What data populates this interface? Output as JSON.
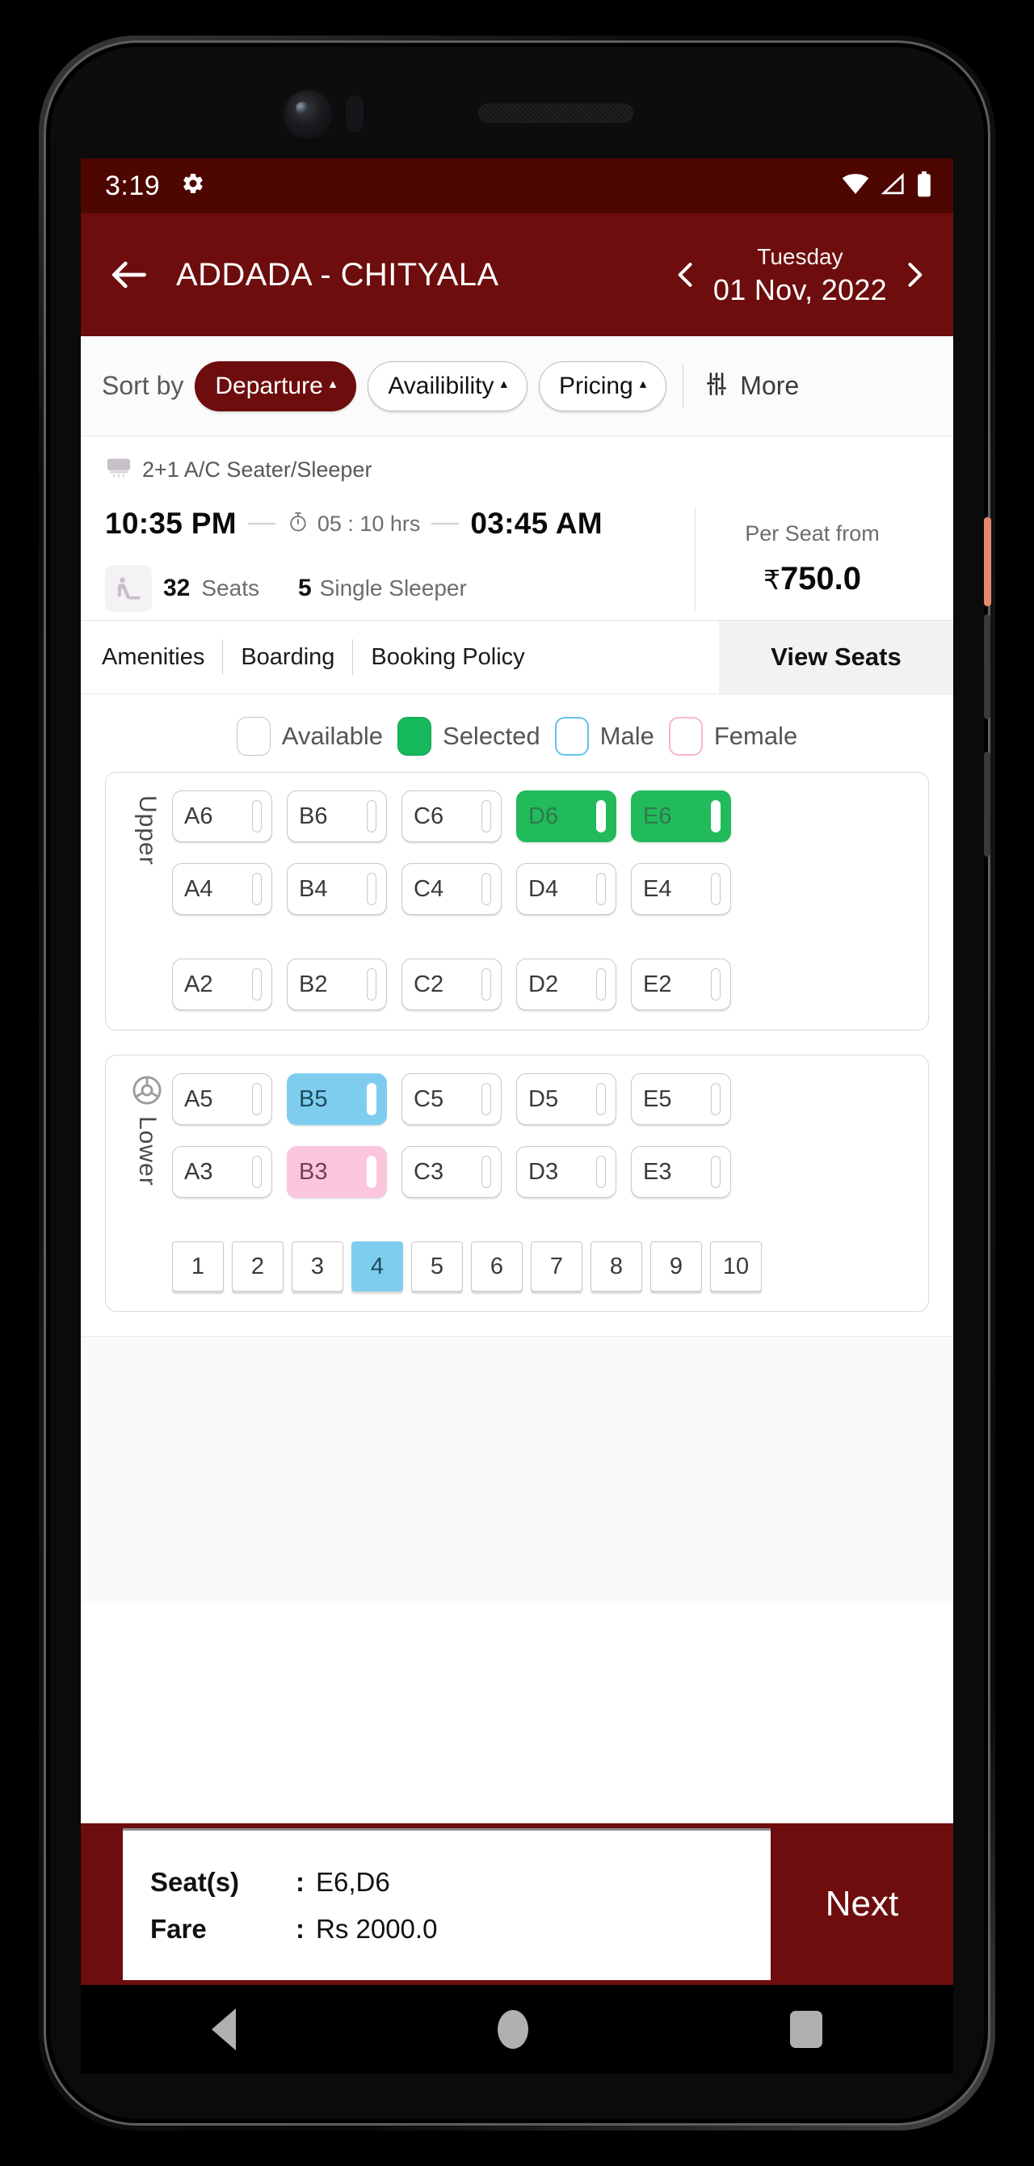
{
  "status_bar": {
    "time": "3:19",
    "gear_icon": "gear-icon",
    "wifi_icon": "wifi-icon",
    "signal_icon": "signal-icon",
    "battery_icon": "battery-icon"
  },
  "app_bar": {
    "back_icon": "back-arrow-icon",
    "route_title": "ADDADA - CHITYALA",
    "prev_icon": "chevron-left-icon",
    "next_icon": "chevron-right-icon",
    "weekday": "Tuesday",
    "date": "01 Nov, 2022"
  },
  "sort_bar": {
    "label": "Sort by",
    "chips": [
      {
        "label": "Departure",
        "active": true,
        "caret": "▴"
      },
      {
        "label": "Availibility",
        "active": false,
        "caret": "▴"
      },
      {
        "label": "Pricing",
        "active": false,
        "caret": "▴"
      }
    ],
    "more_icon": "filter-sliders-icon",
    "more_label": "More"
  },
  "bus_card": {
    "bus_icon": "ac-bus-icon",
    "bus_type": "2+1 A/C Seater/Sleeper",
    "departure_time": "10:35 PM",
    "duration_icon": "stopwatch-icon",
    "duration": "05 : 10 hrs",
    "arrival_time": "03:45 AM",
    "seat_icon": "seat-icon",
    "seats_count": "32",
    "seats_word": "Seats",
    "single_sleeper_count": "5",
    "single_sleeper_word": "Single Sleeper",
    "per_seat_label": "Per Seat from",
    "currency": "₹",
    "price": "750.0"
  },
  "tabs": {
    "items": [
      {
        "label": "Amenities"
      },
      {
        "label": "Boarding"
      },
      {
        "label": "Booking Policy"
      }
    ],
    "view_seats": "View Seats"
  },
  "legend": [
    {
      "label": "Available",
      "state": "available",
      "color": "#ffffff"
    },
    {
      "label": "Selected",
      "state": "selected",
      "color": "#22bb5b"
    },
    {
      "label": "Male",
      "state": "male",
      "color": "#7fcdee"
    },
    {
      "label": "Female",
      "state": "female",
      "color": "#fbc6dc"
    }
  ],
  "decks": {
    "upper": {
      "label": "Upper",
      "rows": [
        [
          {
            "id": "A6",
            "state": "available"
          },
          {
            "id": "B6",
            "state": "available"
          },
          {
            "id": "C6",
            "state": "available"
          },
          {
            "id": "D6",
            "state": "selected"
          },
          {
            "id": "E6",
            "state": "selected"
          }
        ],
        [
          {
            "id": "A4",
            "state": "available"
          },
          {
            "id": "B4",
            "state": "available"
          },
          {
            "id": "C4",
            "state": "available"
          },
          {
            "id": "D4",
            "state": "available"
          },
          {
            "id": "E4",
            "state": "available"
          }
        ],
        [
          {
            "id": "A2",
            "state": "available"
          },
          {
            "id": "B2",
            "state": "available"
          },
          {
            "id": "C2",
            "state": "available"
          },
          {
            "id": "D2",
            "state": "available"
          },
          {
            "id": "E2",
            "state": "available"
          }
        ]
      ]
    },
    "lower": {
      "label": "Lower",
      "steering_icon": "steering-wheel-icon",
      "rows": [
        [
          {
            "id": "A5",
            "state": "available"
          },
          {
            "id": "B5",
            "state": "male"
          },
          {
            "id": "C5",
            "state": "available"
          },
          {
            "id": "D5",
            "state": "available"
          },
          {
            "id": "E5",
            "state": "available"
          }
        ],
        [
          {
            "id": "A3",
            "state": "available"
          },
          {
            "id": "B3",
            "state": "female"
          },
          {
            "id": "C3",
            "state": "available"
          },
          {
            "id": "D3",
            "state": "available"
          },
          {
            "id": "E3",
            "state": "available"
          }
        ]
      ],
      "back_row": [
        {
          "id": "1",
          "state": "available"
        },
        {
          "id": "2",
          "state": "available"
        },
        {
          "id": "3",
          "state": "available"
        },
        {
          "id": "4",
          "state": "male"
        },
        {
          "id": "5",
          "state": "available"
        },
        {
          "id": "6",
          "state": "available"
        },
        {
          "id": "7",
          "state": "available"
        },
        {
          "id": "8",
          "state": "available"
        },
        {
          "id": "9",
          "state": "available"
        },
        {
          "id": "10",
          "state": "available"
        }
      ]
    }
  },
  "bottom_bar": {
    "seats_key": "Seat(s)",
    "seats_colon": ":",
    "seats_value": "E6,D6",
    "fare_key": "Fare",
    "fare_colon": ":",
    "fare_value": "Rs 2000.0",
    "next_label": "Next"
  },
  "nav_bar": {
    "back_icon": "nav-back-icon",
    "home_icon": "nav-home-icon",
    "recents_icon": "nav-recents-icon"
  },
  "colors": {
    "status_bar": "#4d0600",
    "app_bar": "#6d0d0d",
    "accent": "#6d0d0d",
    "selected": "#22bb5b",
    "male": "#7fcdee",
    "female": "#fbc6dc"
  }
}
